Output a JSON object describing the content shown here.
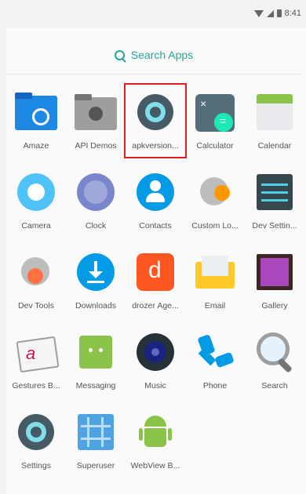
{
  "status_bar": {
    "time": "8:41"
  },
  "search": {
    "label": "Search Apps"
  },
  "apps": [
    {
      "label": "Amaze",
      "icon": "amaze-folder-icon"
    },
    {
      "label": "API Demos",
      "icon": "api-demos-folder-icon"
    },
    {
      "label": "apkversion...",
      "icon": "gear-icon",
      "highlighted": true
    },
    {
      "label": "Calculator",
      "icon": "calculator-icon"
    },
    {
      "label": "Calendar",
      "icon": "calendar-icon"
    },
    {
      "label": "Camera",
      "icon": "camera-icon"
    },
    {
      "label": "Clock",
      "icon": "clock-icon"
    },
    {
      "label": "Contacts",
      "icon": "contacts-icon"
    },
    {
      "label": "Custom Lo...",
      "icon": "custom-locale-icon"
    },
    {
      "label": "Dev Settin...",
      "icon": "dev-settings-icon"
    },
    {
      "label": "Dev Tools",
      "icon": "dev-tools-icon"
    },
    {
      "label": "Downloads",
      "icon": "downloads-icon"
    },
    {
      "label": "drozer Age...",
      "icon": "drozer-icon"
    },
    {
      "label": "Email",
      "icon": "email-icon"
    },
    {
      "label": "Gallery",
      "icon": "gallery-icon"
    },
    {
      "label": "Gestures B...",
      "icon": "gestures-icon"
    },
    {
      "label": "Messaging",
      "icon": "messaging-icon"
    },
    {
      "label": "Music",
      "icon": "music-icon"
    },
    {
      "label": "Phone",
      "icon": "phone-icon"
    },
    {
      "label": "Search",
      "icon": "magnifier-icon"
    },
    {
      "label": "Settings",
      "icon": "settings-icon"
    },
    {
      "label": "Superuser",
      "icon": "superuser-icon"
    },
    {
      "label": "WebView B...",
      "icon": "android-icon"
    }
  ],
  "colors": {
    "accent": "#26a69a",
    "highlight": "#e02020"
  }
}
